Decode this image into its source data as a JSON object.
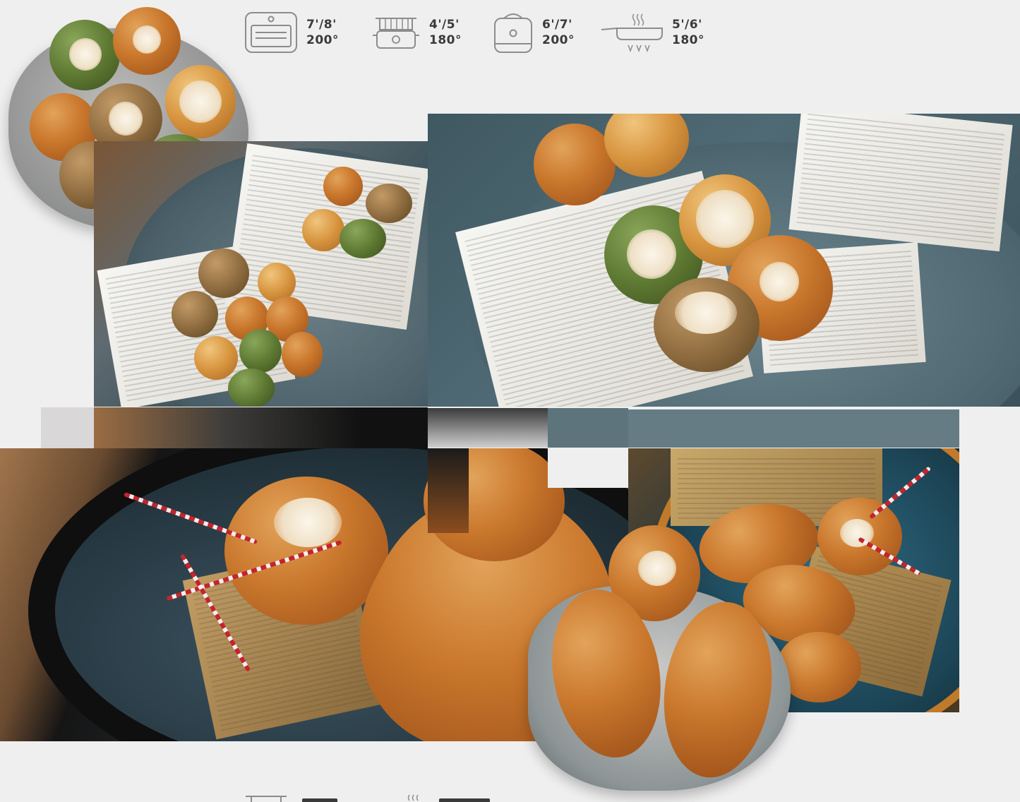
{
  "methods_top": [
    {
      "icon": "oven-icon",
      "time": "7'/8'",
      "temp": "200°"
    },
    {
      "icon": "fryer-icon",
      "time": "4'/5'",
      "temp": "180°"
    },
    {
      "icon": "air-fryer-icon",
      "time": "6'/7'",
      "temp": "200°"
    },
    {
      "icon": "pan-icon",
      "time": "5'/6'",
      "temp": "180°"
    }
  ],
  "methods_bottom_partial": [
    {
      "icon": "fryer-icon"
    },
    {
      "icon": "pan-icon"
    }
  ],
  "colors": {
    "background": "#efefef",
    "icon_stroke": "#8c8c8c",
    "text": "#3a3a3a"
  }
}
